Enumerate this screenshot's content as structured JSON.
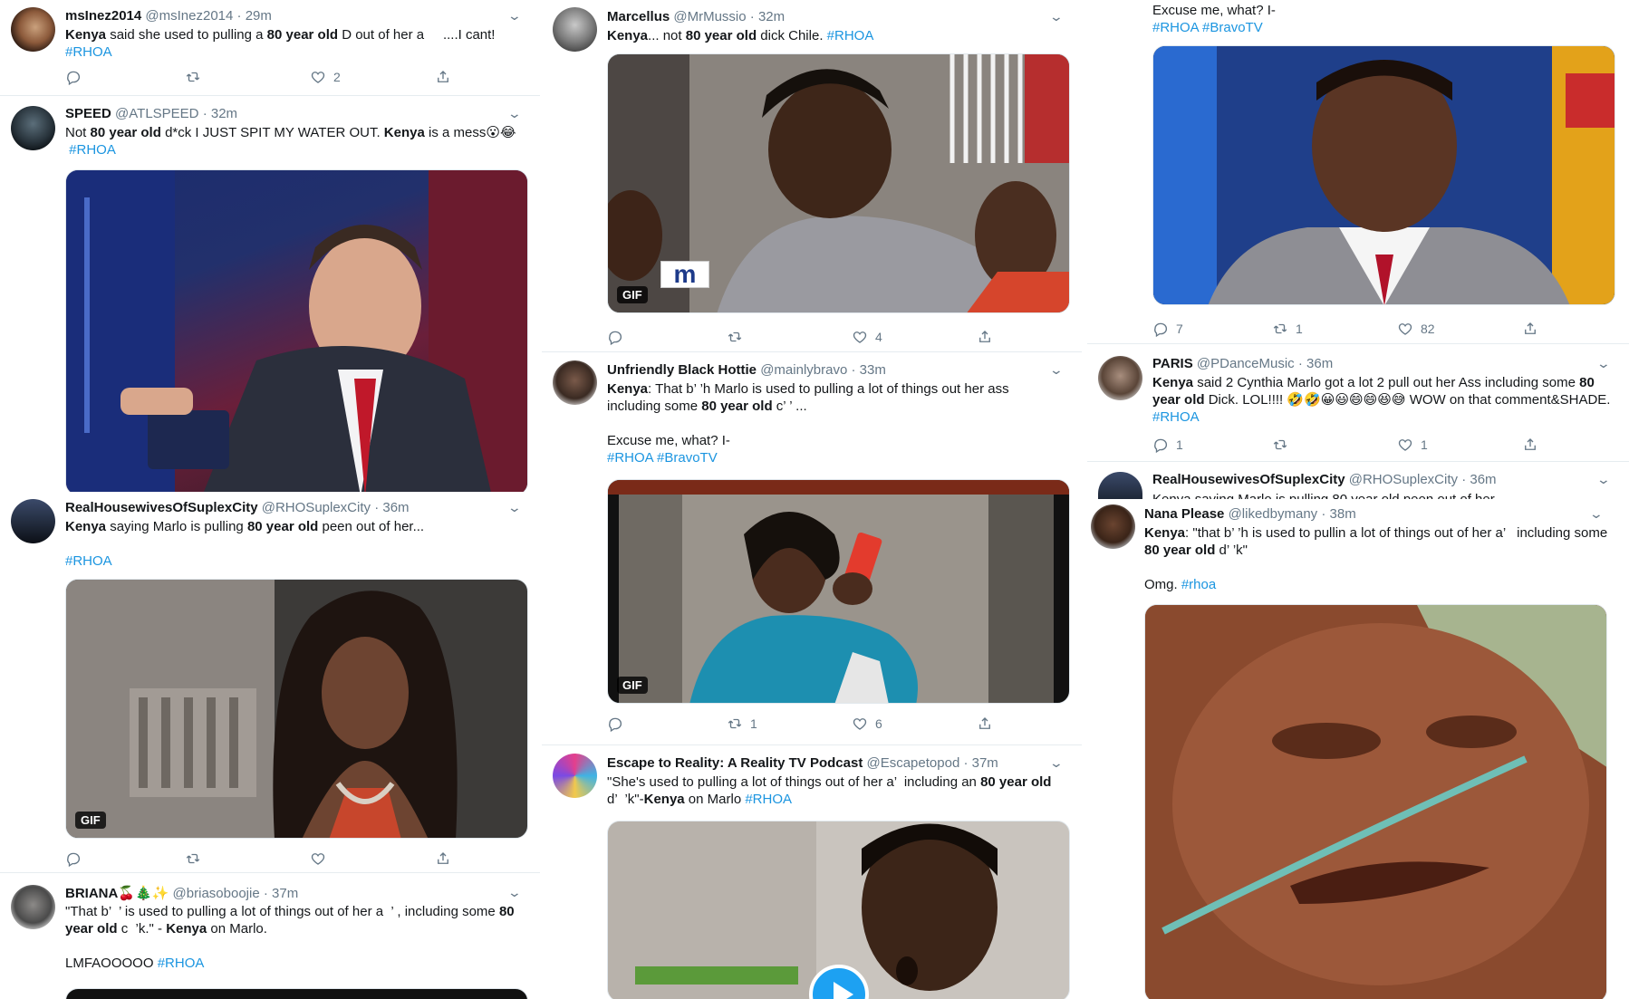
{
  "columns": [
    {
      "tweets": [
        {
          "name": "msInez2014",
          "handle": "@msInez2014",
          "time": "· 29m",
          "text_pre": "",
          "text_kw1": "Kenya",
          "text_mid": " said she used to pulling a ",
          "text_kw2": "80 year old",
          "text_post": " D out of her a     ....I cant!",
          "tags": "#RHOA",
          "counts": {
            "reply": "",
            "retweet": "",
            "like": "2"
          }
        },
        {
          "name": "SPEED",
          "handle": "@ATLSPEED",
          "time": "· 32m",
          "text_pre": "Not ",
          "text_kw1": "80 year old",
          "text_mid": " d*ck I JUST SPIT MY WATER OUT. ",
          "text_kw2": "Kenya",
          "text_post": " is a mess😮😂",
          "tags": "#RHOA",
          "media_badge": ""
        },
        {
          "name": "RealHousewivesOfSuplexCity",
          "handle": "@RHOSuplexCity",
          "time": "· 36m",
          "text_pre": "",
          "text_kw1": "Kenya",
          "text_mid": " saying Marlo is pulling ",
          "text_kw2": "80 year old",
          "text_post": " peen out of her...",
          "tags": "#RHOA",
          "media_badge": "GIF",
          "counts": {
            "reply": "",
            "retweet": "",
            "like": ""
          }
        },
        {
          "name": "BRIANA🍒🎄✨",
          "handle": "@briasoboojie",
          "time": "· 37m",
          "text_pre": "\"That b’  ’ is used to pulling a lot of things out of her a  ’ , including some ",
          "text_kw1": "80 year old",
          "text_mid": " c  ’k.\" - ",
          "text_kw2": "Kenya",
          "text_post": " on Marlo.",
          "extra": "LMFAOOOOO ",
          "tags": "#RHOA"
        }
      ]
    },
    {
      "tweets": [
        {
          "name": "Marcellus",
          "handle": "@MrMussio",
          "time": "· 32m",
          "text_pre": "",
          "text_kw1": "Kenya",
          "text_mid": "... not ",
          "text_kw2": "80 year old",
          "text_post": " dick Chile. ",
          "tags": "#RHOA",
          "media_badge": "GIF",
          "logo": "m",
          "counts": {
            "reply": "",
            "retweet": "",
            "like": "4"
          }
        },
        {
          "name": "Unfriendly Black Hottie",
          "handle": "@mainlybravo",
          "time": "· 33m",
          "text_pre": "",
          "text_kw1": "Kenya",
          "text_mid": ": That b’ ’h Marlo is used to pulling a lot of things out her ass including some ",
          "text_kw2": "80 year old",
          "text_post": " c’ ’ ...",
          "extra": "Excuse me, what? I-",
          "tags": "#RHOA #BravoTV",
          "media_badge": "GIF",
          "counts": {
            "reply": "",
            "retweet": "1",
            "like": "6"
          }
        },
        {
          "name": "Escape to Reality: A Reality TV Podcast",
          "handle": "@Escapetopod",
          "time": "· 37m",
          "text_pre": "\"She's used to pulling a lot of things out of her a’  including an ",
          "text_kw1": "80 year old",
          "text_mid": " d’  ’k\"-",
          "text_kw2": "Kenya",
          "text_post": " on Marlo ",
          "tags": "#RHOA"
        }
      ]
    },
    {
      "tweets": [
        {
          "extra": "Excuse me, what? I-",
          "tags": "#RHOA #BravoTV",
          "counts": {
            "reply": "7",
            "retweet": "1",
            "like": "82"
          }
        },
        {
          "name": "PARIS",
          "handle": "@PDanceMusic",
          "time": "· 36m",
          "text_pre": "",
          "text_kw1": "Kenya",
          "text_mid": " said 2 Cynthia Marlo got a lot 2 pull out her Ass including some ",
          "text_kw2": "80 year old",
          "text_post": " Dick. LOL!!!! 🤣🤣😀😃😄😄😆😅 WOW on that comment&SHADE. ",
          "tags": "#RHOA",
          "counts": {
            "reply": "1",
            "retweet": "",
            "like": "1"
          }
        },
        {
          "name": "RealHousewivesOfSuplexCity",
          "handle": "@RHOSuplexCity",
          "time": "· 36m",
          "text_partial": "Kenya saying Marlo is pulling 80 year old peen out of her"
        },
        {
          "name": "Nana Please",
          "handle": "@likedbymany",
          "time": "· 38m",
          "text_pre": "",
          "text_kw1": "Kenya",
          "text_mid": ": \"that b’ ’h is used to pullin a lot of things out of her a’   including some ",
          "text_kw2": "80 year old",
          "text_post": " d’ ’k\"",
          "extra": "Omg. ",
          "tags": "#rhoa"
        }
      ]
    }
  ],
  "icons": [
    "reply-icon",
    "retweet-icon",
    "like-icon",
    "share-icon",
    "chevron-down-icon"
  ],
  "colors": {
    "link": "#1b95e0",
    "muted": "#657786",
    "divider": "#e6ecf0"
  }
}
